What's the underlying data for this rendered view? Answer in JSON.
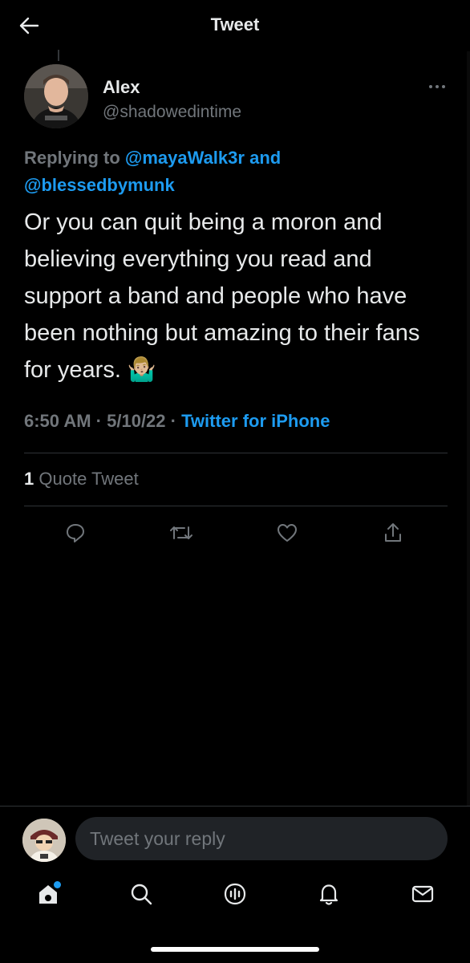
{
  "header": {
    "title": "Tweet",
    "back_icon": "arrow-left-icon"
  },
  "tweet": {
    "author_name": "Alex",
    "author_handle": "@shadowedintime",
    "replying_prefix": "Replying to",
    "replying_to": [
      "@mayaWalk3r",
      "@blessedbymunk"
    ],
    "replying_joiner": "and",
    "text": "Or you can quit being a moron and believing everything you read and support a band and people who have been nothing but amazing to their fans for years. 🤷🏼‍♂️",
    "time": "6:50 AM",
    "date": "5/10/22",
    "separator": "·",
    "source": "Twitter for iPhone",
    "quote_count": "1",
    "quote_label": "Quote Tweet"
  },
  "actions": {
    "reply_icon": "reply-icon",
    "retweet_icon": "retweet-icon",
    "like_icon": "heart-icon",
    "share_icon": "share-icon"
  },
  "reply_box": {
    "placeholder": "Tweet your reply"
  },
  "tabbar": {
    "items": [
      "home-icon",
      "search-icon",
      "spaces-icon",
      "notifications-icon",
      "messages-icon"
    ]
  },
  "colors": {
    "background": "#000000",
    "accent": "#1d9bf0",
    "text": "#e7e9ea",
    "muted": "#71767b"
  }
}
